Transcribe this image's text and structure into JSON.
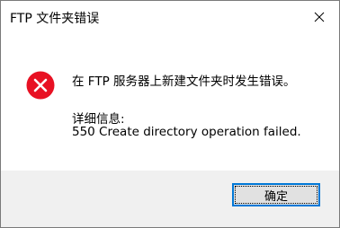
{
  "window": {
    "title": "FTP 文件夹错误",
    "close_icon": "close-icon"
  },
  "message": {
    "icon": "error-icon",
    "icon_color": "#e81123",
    "main": "在 FTP 服务器上新建文件夹时发生错误。",
    "details_label": "详细信息:",
    "details": "550 Create directory operation failed."
  },
  "buttons": {
    "ok_label": "确定",
    "accent": "#0078d7"
  }
}
